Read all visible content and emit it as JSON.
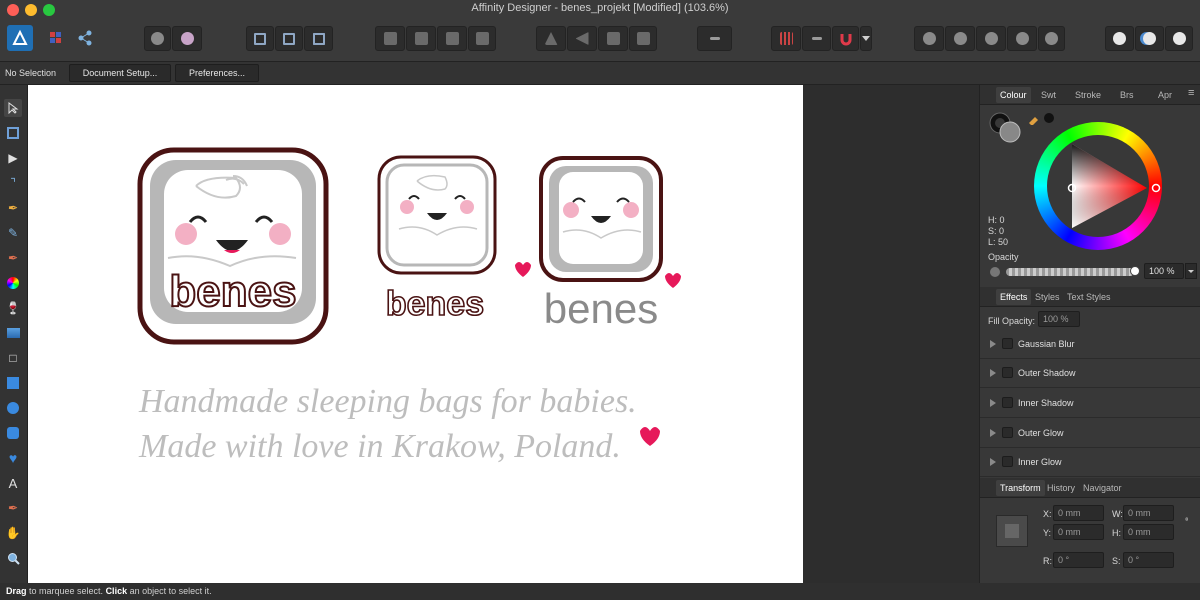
{
  "window": {
    "title": "Affinity Designer - benes_projekt [Modified] (103.6%)"
  },
  "context_bar": {
    "status": "No Selection",
    "document_setup": "Document Setup...",
    "preferences": "Preferences..."
  },
  "artwork": {
    "logo_text": "benes",
    "tagline_line1": "Handmade sleeping bags for babies.",
    "tagline_line2": "Made with love in Krakow, Poland."
  },
  "colors": {
    "accent": "#1f6fb4",
    "logo_dark": "#4a1313",
    "logo_gray": "#b7b7b7",
    "heart_pink": "#e6195a",
    "tagline_gray": "#bdbdbd"
  },
  "colour_panel": {
    "tabs": [
      "Colour",
      "Swt",
      "Stroke",
      "Brs",
      "Apr"
    ],
    "h": "H: 0",
    "s": "S: 0",
    "l": "L: 50",
    "opacity_label": "Opacity",
    "opacity_value": "100 %"
  },
  "effects_panel": {
    "tabs": [
      "Effects",
      "Styles",
      "Text Styles"
    ],
    "fill_opacity_label": "Fill Opacity:",
    "fill_opacity_value": "100 %",
    "effects": [
      "Gaussian Blur",
      "Outer Shadow",
      "Inner Shadow",
      "Outer Glow",
      "Inner Glow"
    ]
  },
  "transform_panel": {
    "tabs": [
      "Transform",
      "History",
      "Navigator"
    ],
    "x_label": "X:",
    "x_value": "0 mm",
    "y_label": "Y:",
    "y_value": "0 mm",
    "w_label": "W:",
    "w_value": "0 mm",
    "h_label": "H:",
    "h_value": "0 mm",
    "r_label": "R:",
    "r_value": "0 °",
    "s_label": "S:",
    "s_value": "0 °"
  },
  "status_bar": {
    "drag_bold": "Drag",
    "drag_text": " to marquee select. ",
    "click_bold": "Click",
    "click_text": " an object to select it."
  }
}
